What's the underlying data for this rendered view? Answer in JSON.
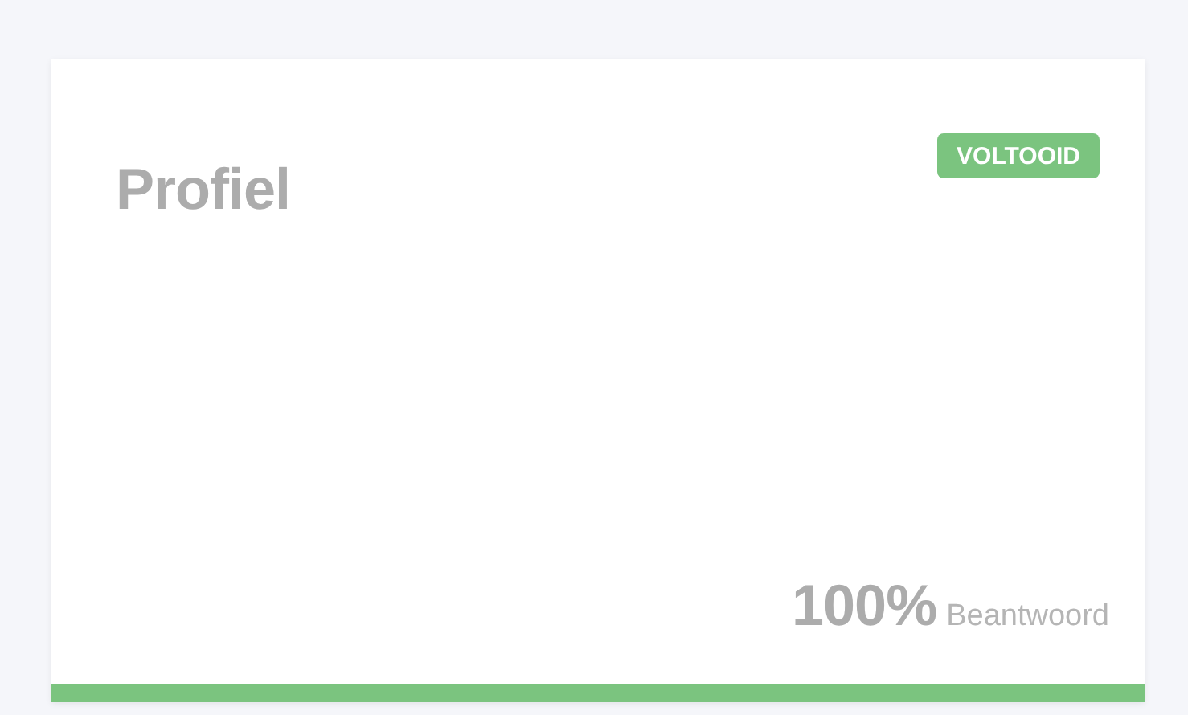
{
  "card": {
    "title": "Profiel",
    "badge": {
      "label": "VOLTOOID",
      "kind": "complete"
    },
    "percentage": "100%",
    "caption": "Beantwoord",
    "progress": {
      "level": 1
    }
  }
}
